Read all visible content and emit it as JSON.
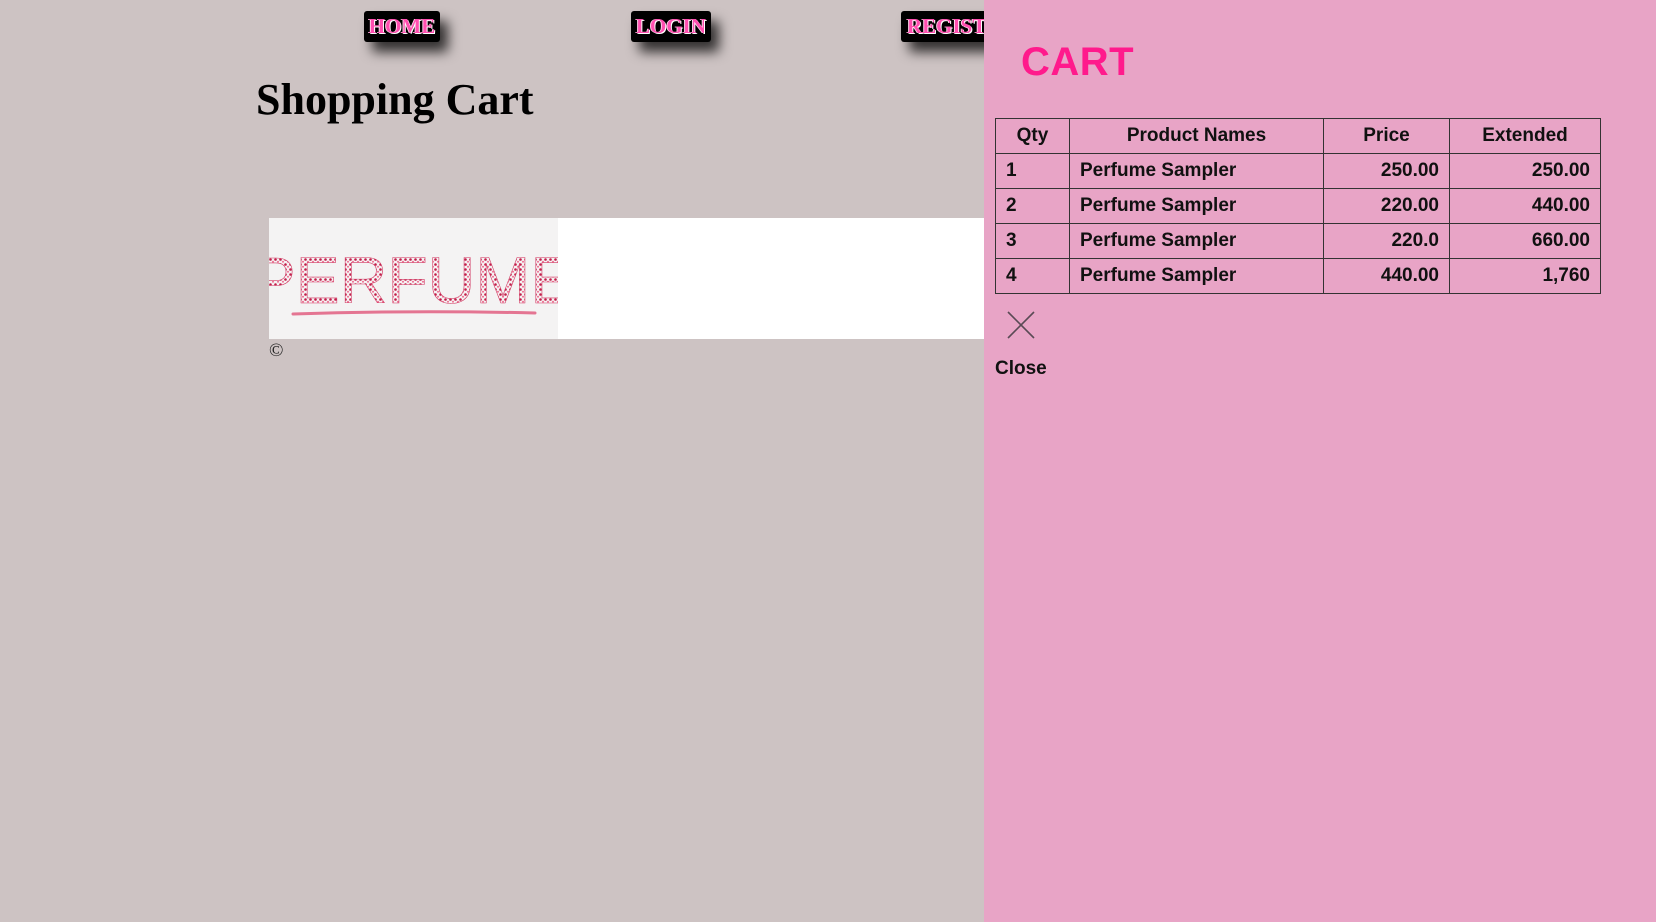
{
  "nav": {
    "home_label": "HOME",
    "login_label": "LOGIN",
    "register_label": "REGIST"
  },
  "page": {
    "title": "Shopping Cart",
    "copyright": "©"
  },
  "banner": {
    "logo_text": "PERFUME"
  },
  "cart": {
    "title": "CART",
    "columns": [
      "Qty",
      "Product Names",
      "Price",
      "Extended"
    ],
    "rows": [
      {
        "qty": "1",
        "name": "Perfume Sampler",
        "price": "250.00",
        "extended": "250.00"
      },
      {
        "qty": "2",
        "name": "Perfume Sampler",
        "price": "220.00",
        "extended": "440.00"
      },
      {
        "qty": "3",
        "name": "Perfume Sampler",
        "price": "220.0",
        "extended": "660.00"
      },
      {
        "qty": "4",
        "name": "Perfume Sampler",
        "price": "440.00",
        "extended": "1,760"
      }
    ],
    "close_label": "Close",
    "close_icon": "close-icon"
  },
  "colors": {
    "page_background": "#cdc3c3",
    "panel_background": "#e8a4c6",
    "cart_title": "#ff1a8c",
    "nav_text": "#ff4fb0"
  }
}
